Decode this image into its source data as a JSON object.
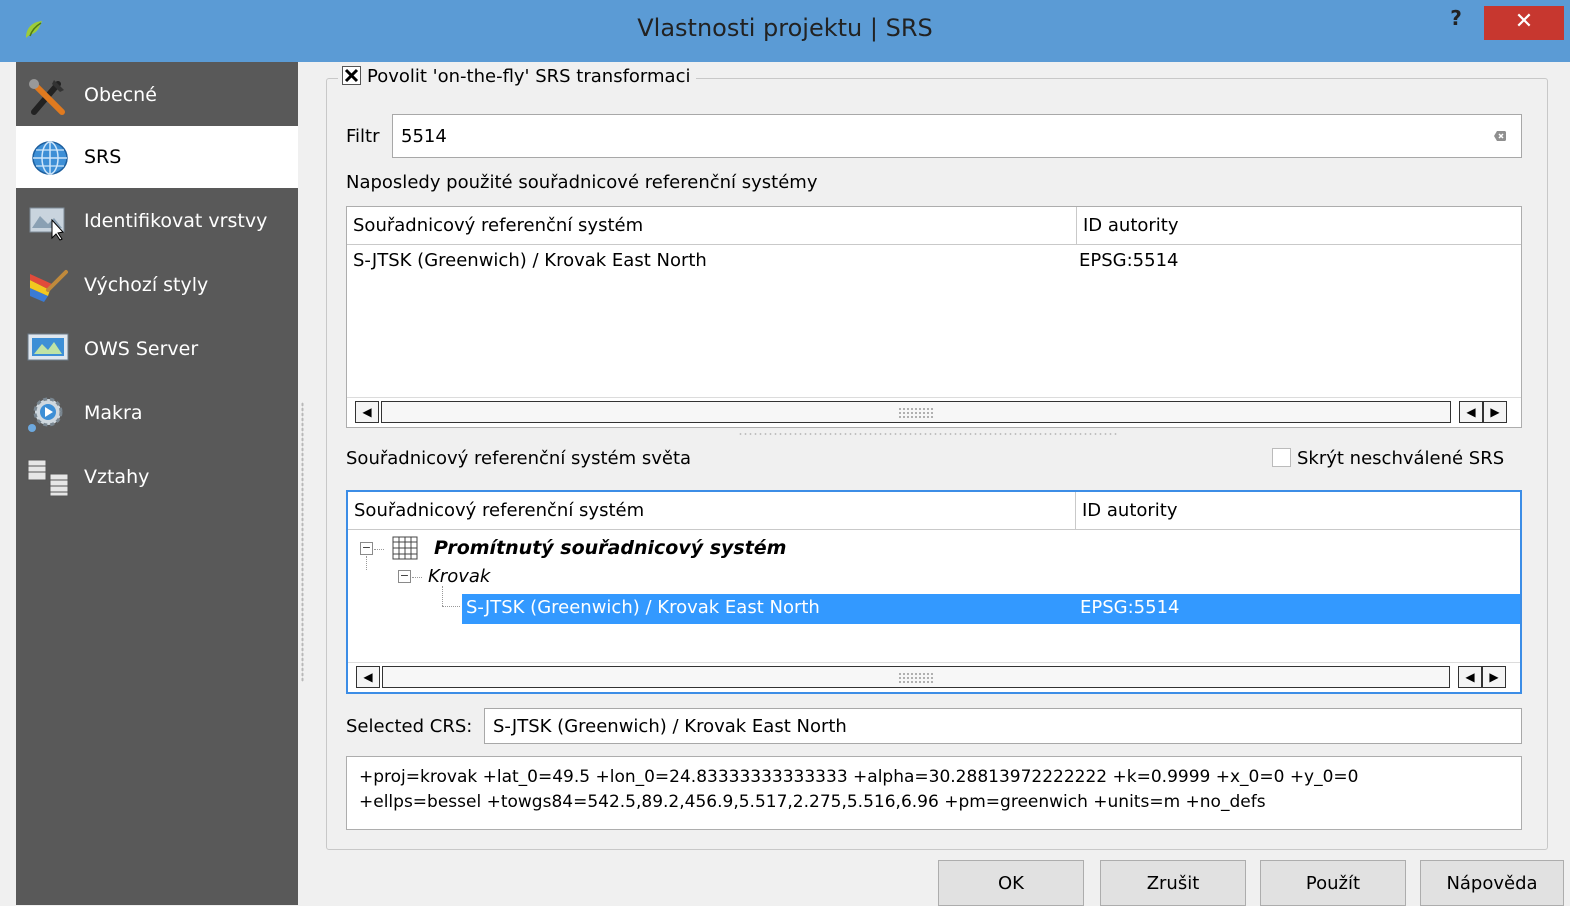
{
  "window": {
    "title": "Vlastnosti projektu | SRS",
    "help_label": "?",
    "close_label": "✕"
  },
  "sidebar": {
    "items": [
      {
        "label": "Obecné",
        "icon": "tools-icon"
      },
      {
        "label": "SRS",
        "icon": "globe-icon",
        "active": true
      },
      {
        "label": "Identifikovat vrstvy",
        "icon": "identify-layers-icon"
      },
      {
        "label": "Výchozí styly",
        "icon": "paint-brush-icon"
      },
      {
        "label": "OWS Server",
        "icon": "ows-server-icon"
      },
      {
        "label": "Makra",
        "icon": "macro-gear-icon"
      },
      {
        "label": "Vztahy",
        "icon": "relations-table-icon"
      }
    ]
  },
  "srs": {
    "otf_label": "Povolit 'on-the-fly' SRS transformaci",
    "otf_checked": true,
    "filter_label": "Filtr",
    "filter_value": "5514",
    "recent_label": "Naposledy použité souřadnicové referenční systémy",
    "recent_table": {
      "columns": [
        "Souřadnicový referenční systém",
        "ID autority"
      ],
      "rows": [
        {
          "name": "S-JTSK (Greenwich) / Krovak East North",
          "id": "EPSG:5514"
        }
      ]
    },
    "world_label": "Souřadnicový referenční systém světa",
    "hide_deprecated_label": "Skrýt neschválené SRS",
    "hide_deprecated_checked": false,
    "world_table": {
      "columns": [
        "Souřadnicový referenční systém",
        "ID autority"
      ],
      "group": "Promítnutý souřadnicový systém",
      "subgroup": "Krovak",
      "selected_row": {
        "name": "S-JTSK (Greenwich) / Krovak East North",
        "id": "EPSG:5514"
      }
    },
    "selected_crs_label": "Selected CRS:",
    "selected_crs_value": "S-JTSK (Greenwich) / Krovak East North",
    "proj_line1": "+proj=krovak +lat_0=49.5 +lon_0=24.83333333333333 +alpha=30.28813972222222 +k=0.9999 +x_0=0 +y_0=0",
    "proj_line2": "+ellps=bessel +towgs84=542.5,89.2,456.9,5.517,2.275,5.516,6.96 +pm=greenwich +units=m +no_defs"
  },
  "buttons": {
    "ok": "OK",
    "cancel": "Zrušit",
    "apply": "Použít",
    "help": "Nápověda"
  },
  "colors": {
    "titlebar": "#5b9bd5",
    "close": "#c7372f",
    "sidebar": "#595959",
    "selection": "#3399ff"
  }
}
